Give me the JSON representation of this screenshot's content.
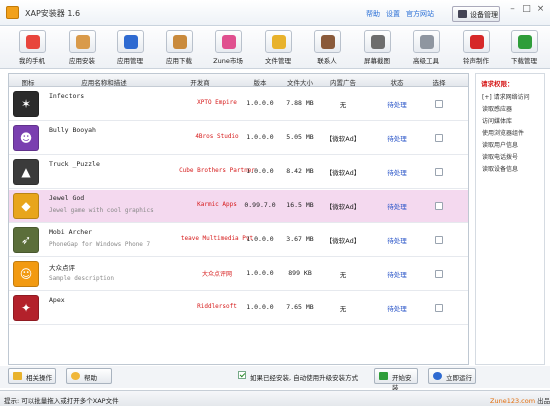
{
  "window": {
    "title": "XAP安装器 1.6",
    "links": [
      "帮助",
      "设置",
      "官方网站"
    ],
    "device_button": "设备管理",
    "controls": [
      "–",
      "□",
      "×"
    ]
  },
  "toolbar": [
    {
      "label": "我的手机",
      "icon": "phone-bars-icon",
      "color": "#e8453c"
    },
    {
      "label": "应用安装",
      "icon": "package-icon",
      "color": "#d99a4a"
    },
    {
      "label": "应用管理",
      "icon": "up-arrow-circle-icon",
      "color": "#2e6ad1"
    },
    {
      "label": "应用下载",
      "icon": "package-download-icon",
      "color": "#c98a3c"
    },
    {
      "label": "Zune市场",
      "icon": "zune-icon",
      "color": "#e0508f"
    },
    {
      "label": "文件管理",
      "icon": "folder-icon",
      "color": "#e8b22c"
    },
    {
      "label": "联系人",
      "icon": "contact-icon",
      "color": "#8a5a3a"
    },
    {
      "label": "屏幕截图",
      "icon": "camera-icon",
      "color": "#6d6d6d"
    },
    {
      "label": "高级工具",
      "icon": "wrench-icon",
      "color": "#8f96a0"
    },
    {
      "label": "铃声制作",
      "icon": "bell-icon",
      "color": "#d62828"
    },
    {
      "label": "下载管理",
      "icon": "download-circle-icon",
      "color": "#2f9d3a"
    }
  ],
  "table": {
    "headers": [
      "图标",
      "应用名称和描述",
      "开发商",
      "版本",
      "文件大小",
      "内置广告",
      "状态",
      "选择"
    ],
    "rows": [
      {
        "name": "Infectors",
        "desc": "",
        "developer": "XPTO Empire",
        "version": "1.0.0.0",
        "size": "7.88 MB",
        "ads": "无",
        "status": "待处理",
        "icon_char": "✶",
        "icon_color": "#2b2b2b"
      },
      {
        "name": "Bully Booyah",
        "desc": "",
        "developer": "4Bros Studio",
        "version": "1.0.0.0",
        "size": "5.05 MB",
        "ads": "【微软Ad】",
        "status": "待处理",
        "icon_char": "☻",
        "icon_color": "#7a3fb0"
      },
      {
        "name": "Truck _Puzzle",
        "desc": "",
        "developer": "Cube Brothers Partner",
        "version": "1.0.0.0",
        "size": "8.42 MB",
        "ads": "【微软Ad】",
        "status": "待处理",
        "icon_char": "▲",
        "icon_color": "#3b3b3b"
      },
      {
        "name": "Jewel God",
        "desc": "Jewel game with cool graphics",
        "developer": "Karmic Apps",
        "version": "0.99.7.0",
        "size": "16.5 MB",
        "ads": "【微软Ad】",
        "status": "待处理",
        "icon_char": "◆",
        "icon_color": "#e8a51c"
      },
      {
        "name": "Mobi Archer",
        "desc": "PhoneGap for Windows Phone 7",
        "developer": "teave Multimedia Pvt",
        "version": "1.0.0.0",
        "size": "3.67 MB",
        "ads": "【微软Ad】",
        "status": "待处理",
        "icon_char": "➶",
        "icon_color": "#5b6e3a"
      },
      {
        "name": "大众点评",
        "desc": "Sample description",
        "developer": "大众点评网",
        "version": "1.0.0.0",
        "size": "899 KB",
        "ads": "无",
        "status": "待处理",
        "icon_char": "☺",
        "icon_color": "#f29a11"
      },
      {
        "name": "Apex",
        "desc": "",
        "developer": "Riddlersoft",
        "version": "1.0.0.0",
        "size": "7.65 MB",
        "ads": "无",
        "status": "待处理",
        "icon_char": "✦",
        "icon_color": "#b3212b"
      }
    ]
  },
  "permissions": {
    "title": "请求权限：",
    "items": [
      "[+] 请求网络访问",
      "读取感应器",
      "访问媒体库",
      "使用浏览器组件",
      "读取用户信息",
      "读取电话拨号",
      "读取设备信息"
    ]
  },
  "bottom": {
    "related_button": "相关操作",
    "help_button": "帮助",
    "upgrade_label": "如果已经安装, 自动使用升级安装方式",
    "start_button": "开始安装",
    "run_button": "立即运行"
  },
  "statusbar": {
    "hint": "提示: 可以批量拖入或打开多个XAP文件",
    "brand_name": "Zune123.com",
    "brand_suffix": "出品"
  }
}
